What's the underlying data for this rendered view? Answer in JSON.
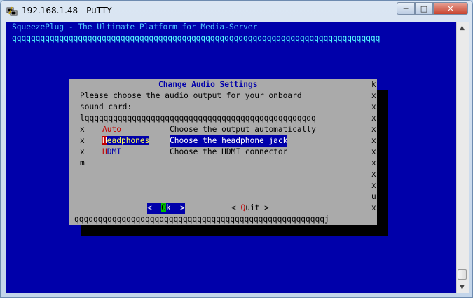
{
  "window": {
    "title": "192.168.1.48 - PuTTY",
    "controls": {
      "minimize": "─",
      "maximize": "□",
      "close": "✕"
    }
  },
  "terminal": {
    "header": "SqueezePlug - The Ultimate Platform for Media-Server",
    "header_rule": "qqqqqqqqqqqqqqqqqqqqqqqqqqqqqqqqqqqqqqqqqqqqqqqqqqqqqqqqqqqqqqqqqqqqqqqqqqqqqq"
  },
  "dialog": {
    "title": "Change Audio Settings",
    "prompt_line1": "Please choose the audio output for your onboard",
    "prompt_line2": "sound card:",
    "menu_top_border": "lqqqqqqqqqqqqqqqqqqqqqqqqqqqqqqqqqqqqqqqqqqqqqqqqq",
    "left_edge": "x",
    "bottom_left_corner": "m",
    "right_edge_chars": [
      "k",
      "x",
      "x",
      "x",
      "x",
      "x",
      "x",
      "x",
      "x",
      "x",
      "u",
      "x"
    ],
    "bottom_border": "qqqqqqqqqqqqqqqqqqqqqqqqqqqqqqqqqqqqqqqqqqqqqqqqqqqqqj",
    "items": [
      {
        "hot": "A",
        "rest": "uto",
        "desc": "Choose the output automatically",
        "selected": false
      },
      {
        "hot": "H",
        "rest": "eadphones",
        "desc": "Choose the headphone jack",
        "selected": true
      },
      {
        "hot": "H",
        "rest": "DMI",
        "desc": "Choose the HDMI connector",
        "selected": false
      }
    ],
    "ok_button": {
      "open": "<  ",
      "hot": "O",
      "rest": "k  >"
    },
    "quit_button": {
      "open": "< ",
      "hot": "Q",
      "rest": "uit >"
    }
  },
  "colors": {
    "terminal_bg": "#0000aa",
    "dialog_bg": "#aaaaaa",
    "accent_red": "#c00000",
    "title_blue": "#0000aa"
  }
}
